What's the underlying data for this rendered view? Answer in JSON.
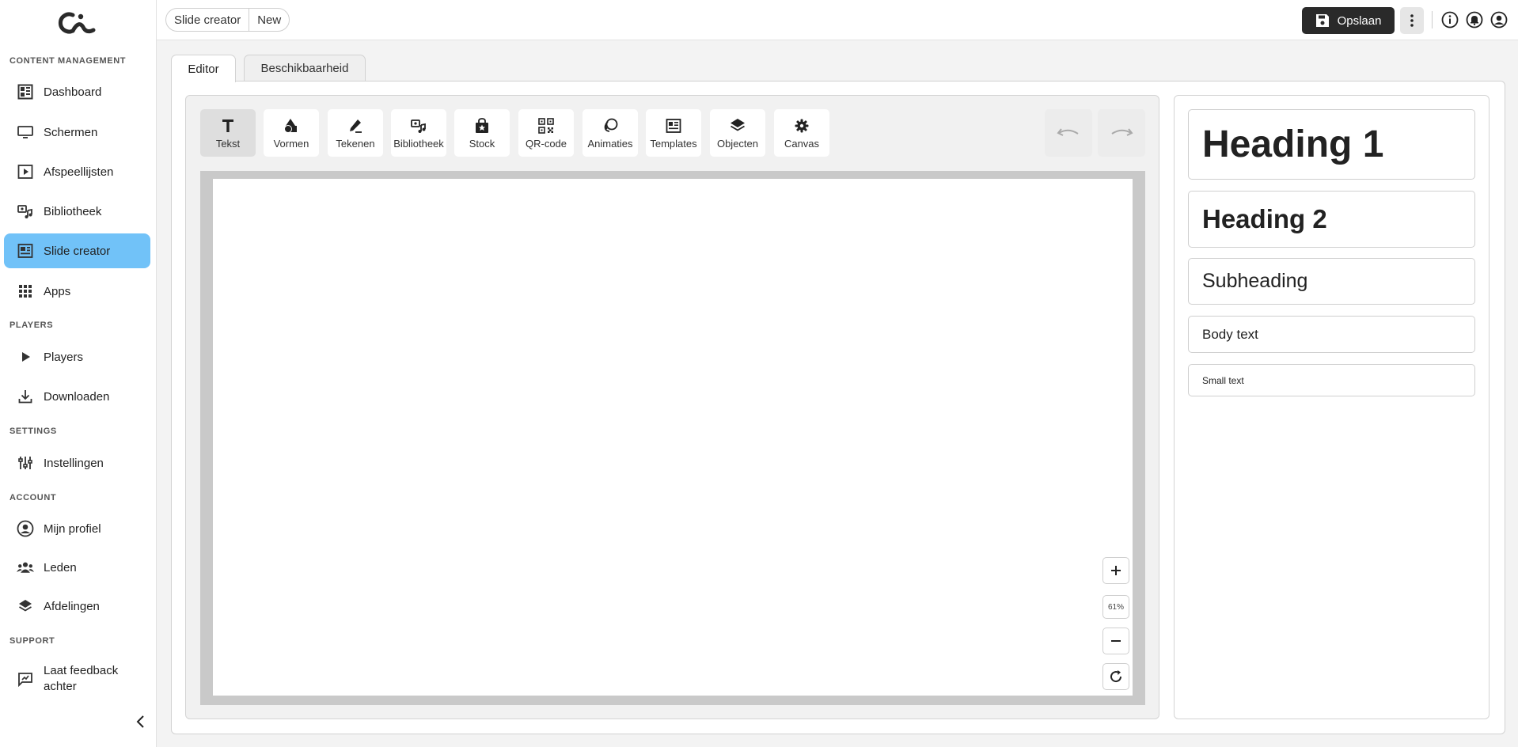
{
  "sidebar": {
    "sections": {
      "content": "CONTENT MANAGEMENT",
      "players": "PLAYERS",
      "settings": "SETTINGS",
      "account": "ACCOUNT",
      "support": "SUPPORT"
    },
    "items": [
      {
        "label": "Dashboard",
        "icon": "dashboard-icon"
      },
      {
        "label": "Schermen",
        "icon": "monitor-icon"
      },
      {
        "label": "Afspeellijsten",
        "icon": "playlist-icon"
      },
      {
        "label": "Bibliotheek",
        "icon": "media-library-icon"
      },
      {
        "label": "Slide creator",
        "icon": "slide-creator-icon",
        "active": true
      },
      {
        "label": "Apps",
        "icon": "apps-grid-icon"
      },
      {
        "label": "Players",
        "icon": "play-icon"
      },
      {
        "label": "Downloaden",
        "icon": "download-icon"
      },
      {
        "label": "Instellingen",
        "icon": "sliders-icon"
      },
      {
        "label": "Mijn profiel",
        "icon": "profile-icon"
      },
      {
        "label": "Leden",
        "icon": "users-icon"
      },
      {
        "label": "Afdelingen",
        "icon": "layers-icon"
      },
      {
        "label": "Laat feedback achter",
        "icon": "feedback-icon"
      }
    ]
  },
  "breadcrumb": [
    "Slide creator",
    "New"
  ],
  "header": {
    "save_label": "Opslaan"
  },
  "tabs": [
    {
      "label": "Editor",
      "active": true
    },
    {
      "label": "Beschikbaarheid",
      "active": false
    }
  ],
  "toolbar": [
    {
      "label": "Tekst",
      "icon": "text-icon",
      "active": true
    },
    {
      "label": "Vormen",
      "icon": "shapes-icon"
    },
    {
      "label": "Tekenen",
      "icon": "pen-icon"
    },
    {
      "label": "Bibliotheek",
      "icon": "media-library-icon"
    },
    {
      "label": "Stock",
      "icon": "stock-bag-icon"
    },
    {
      "label": "QR-code",
      "icon": "qr-code-icon"
    },
    {
      "label": "Animaties",
      "icon": "animation-icon"
    },
    {
      "label": "Templates",
      "icon": "templates-icon"
    },
    {
      "label": "Objecten",
      "icon": "layers-icon"
    },
    {
      "label": "Canvas",
      "icon": "gear-icon"
    }
  ],
  "zoom": {
    "level": "61%"
  },
  "text_presets": {
    "heading1": "Heading 1",
    "heading2": "Heading 2",
    "subheading": "Subheading",
    "body": "Body text",
    "small": "Small text"
  },
  "colors": {
    "active_nav": "#71c2f8",
    "save_button": "#2a2a2a",
    "canvas_frame": "#c9c9c9"
  }
}
